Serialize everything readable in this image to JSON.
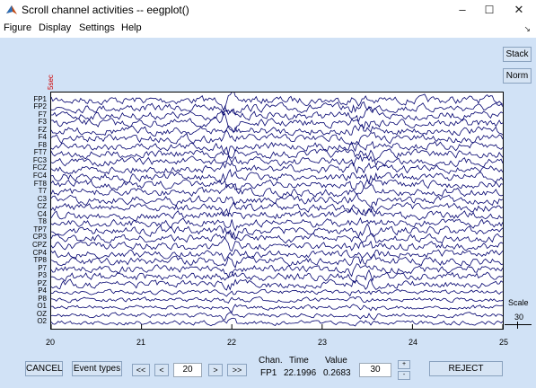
{
  "window": {
    "title": "Scroll channel activities -- eegplot()",
    "minimize": "–",
    "maximize": "☐",
    "close": "✕"
  },
  "menu": {
    "items": [
      "Figure",
      "Display",
      "Settings",
      "Help"
    ]
  },
  "plot": {
    "scale_mark_label": "5sec",
    "channels": [
      "FP1",
      "FP2",
      "F7",
      "F3",
      "FZ",
      "F4",
      "F8",
      "FT7",
      "FC3",
      "FCZ",
      "FC4",
      "FT8",
      "T7",
      "C3",
      "CZ",
      "C4",
      "T8",
      "TP7",
      "CP3",
      "CPZ",
      "CP4",
      "TP8",
      "P7",
      "P3",
      "PZ",
      "P4",
      "P8",
      "O1",
      "OZ",
      "O2"
    ],
    "x_ticks": [
      "20",
      "21",
      "22",
      "23",
      "24",
      "25"
    ],
    "x_range": [
      20,
      25
    ],
    "trace_color": "#00006e",
    "background_color": "#d1e2f6"
  },
  "side": {
    "stack_label": "Stack",
    "norm_label": "Norm",
    "scale_label": "Scale",
    "scale_value": "30"
  },
  "bottom": {
    "cancel_label": "CANCEL",
    "event_types_label": "Event types",
    "prev_fast": "<<",
    "prev": "<",
    "position_value": "20",
    "next": ">",
    "next_fast": ">>",
    "chan_header": "Chan.",
    "time_header": "Time",
    "value_header": "Value",
    "chan_value": "FP1",
    "time_value": "22.1996",
    "value_value": "0.2683",
    "scale_field_value": "30",
    "scale_up": "+",
    "scale_down": "-",
    "reject_label": "REJECT"
  }
}
